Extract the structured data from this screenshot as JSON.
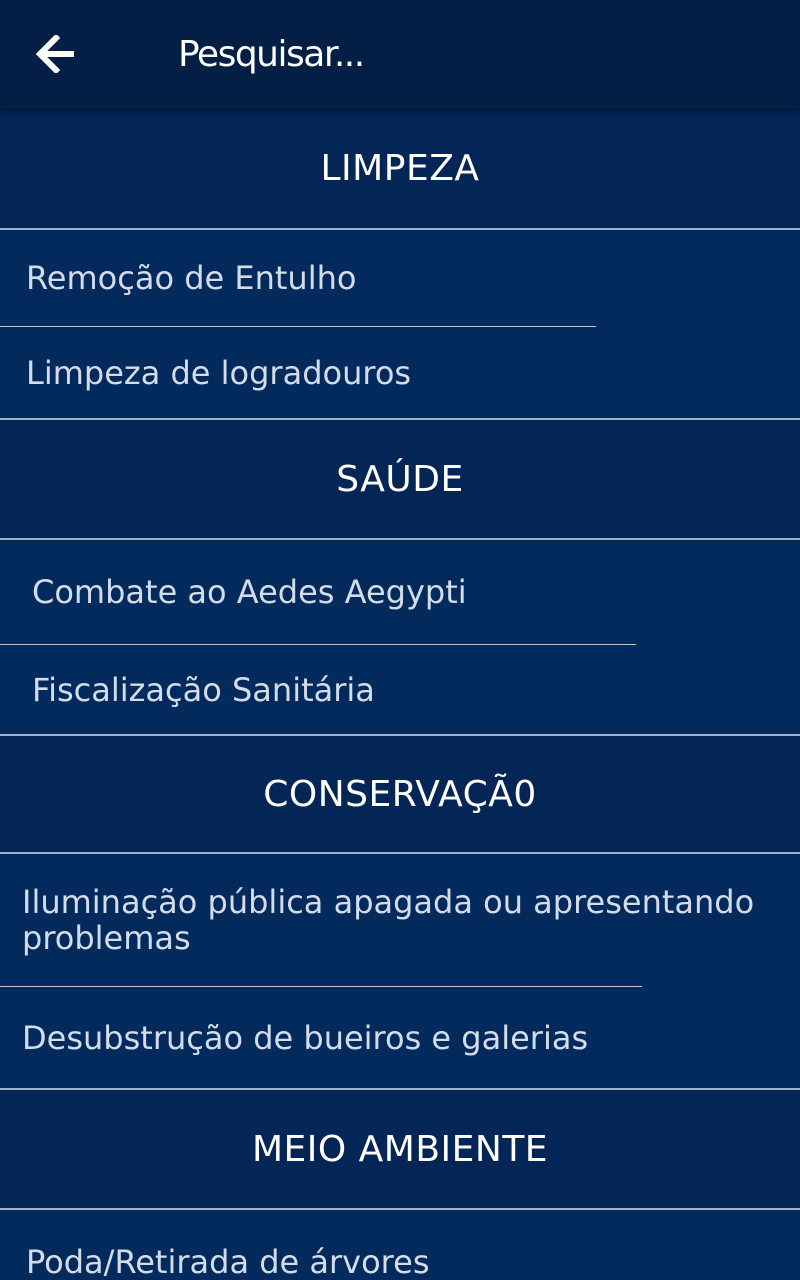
{
  "search": {
    "placeholder": "Pesquisar...",
    "back_icon": "arrow-left-icon"
  },
  "sections": [
    {
      "title": "LIMPEZA",
      "items": [
        "Remoção de Entulho",
        "Limpeza de logradouros"
      ]
    },
    {
      "title": "SAÚDE",
      "items": [
        "Combate ao Aedes Aegypti",
        "Fiscalização Sanitária"
      ]
    },
    {
      "title": "CONSERVAÇÃ0",
      "items": [
        "Iluminação pública apagada ou apresentando problemas",
        "Desubstrução de bueiros e galerias"
      ]
    },
    {
      "title": "MEIO AMBIENTE",
      "items": [
        "Poda/Retirada de árvores"
      ]
    }
  ],
  "colors": {
    "background": "#022a5c",
    "appbar": "#041f45",
    "header": "#032656",
    "text": "#ffffff",
    "item_text": "#d4dcea"
  }
}
